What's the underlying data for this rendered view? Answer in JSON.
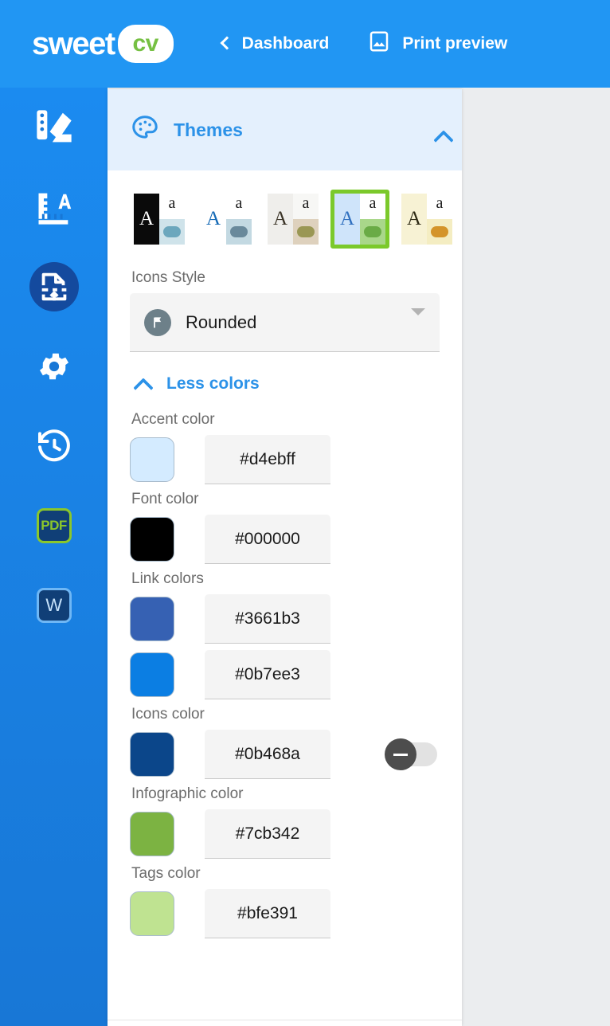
{
  "header": {
    "logo_word": "sweet",
    "logo_pill": "cv",
    "back_icon": "chevron-left-icon",
    "dashboard_label": "Dashboard",
    "print_icon": "image-icon",
    "print_label": "Print preview",
    "bg_color": "#2196f3",
    "logo_pill_color": "#76c043"
  },
  "sidebar": {
    "items": [
      {
        "name": "themes",
        "icon": "palette-swatches-icon",
        "active": false
      },
      {
        "name": "typography",
        "icon": "ruler-letter-icon",
        "active": false
      },
      {
        "name": "layout",
        "icon": "document-upload-icon",
        "active": true
      },
      {
        "name": "settings",
        "icon": "gear-icon",
        "active": false
      },
      {
        "name": "history",
        "icon": "history-clock-icon",
        "active": false
      },
      {
        "name": "export-pdf",
        "icon": "pdf-badge-icon",
        "label": "PDF",
        "active": false
      },
      {
        "name": "export-word",
        "icon": "word-badge-icon",
        "label": "W",
        "active": false
      }
    ]
  },
  "panel": {
    "icon": "palette-icon",
    "title": "Themes",
    "collapse_icon": "chevron-up-icon",
    "header_bg": "#e4f0fd",
    "title_color": "#2c92e8"
  },
  "themes": {
    "selected_index": 3,
    "selection_color": "#7bc92b",
    "items": [
      {
        "name": "theme-dark",
        "letter": "A",
        "small_letter": "a",
        "left_bg": "#0a0a0a",
        "left_fg": "#ffffff",
        "small_bg": "#ffffff",
        "small_fg": "#1a1a1a",
        "dot_bg": "#cfe3ea",
        "dot_color": "#6ca7bd"
      },
      {
        "name": "theme-white-blue",
        "letter": "A",
        "small_letter": "a",
        "left_bg": "#ffffff",
        "left_fg": "#1469b5",
        "small_bg": "#ffffff",
        "small_fg": "#1a1a1a",
        "dot_bg": "#c3d9e2",
        "dot_color": "#69899b"
      },
      {
        "name": "theme-cream-olive",
        "letter": "A",
        "small_letter": "a",
        "left_bg": "#efeeeb",
        "left_fg": "#3a3326",
        "small_bg": "#f7f7f5",
        "small_fg": "#1a1a1a",
        "dot_bg": "#ded1bd",
        "dot_color": "#9a9754"
      },
      {
        "name": "theme-blue-green",
        "letter": "A",
        "small_letter": "a",
        "left_bg": "#cfe4fa",
        "left_fg": "#2f6fbf",
        "small_bg": "#ffffff",
        "small_fg": "#1a1a1a",
        "dot_bg": "#a9d78a",
        "dot_color": "#6aab46"
      },
      {
        "name": "theme-ivory-orange",
        "letter": "A",
        "small_letter": "a",
        "left_bg": "#f7f2d4",
        "left_fg": "#2e2a14",
        "small_bg": "#ffffff",
        "small_fg": "#1a1a1a",
        "dot_bg": "#f4edc2",
        "dot_color": "#d4942a"
      }
    ]
  },
  "icons_style": {
    "label": "Icons Style",
    "value": "Rounded",
    "glyph_icon": "flag-circle-icon",
    "glyph_bg": "#6d8089",
    "caret_icon": "caret-down-icon",
    "options": [
      "Rounded"
    ]
  },
  "less_colors": {
    "icon": "chevron-up-icon",
    "label": "Less colors"
  },
  "colors": [
    {
      "name": "accent-color",
      "label": "Accent color",
      "rows": [
        {
          "swatch": "#d4ebff",
          "value": "#d4ebff"
        }
      ]
    },
    {
      "name": "font-color",
      "label": "Font color",
      "rows": [
        {
          "swatch": "#000000",
          "value": "#000000"
        }
      ]
    },
    {
      "name": "link-colors",
      "label": "Link colors",
      "rows": [
        {
          "swatch": "#3661b3",
          "value": "#3661b3"
        },
        {
          "swatch": "#0b7ee3",
          "value": "#0b7ee3"
        }
      ]
    },
    {
      "name": "icons-color",
      "label": "Icons color",
      "rows": [
        {
          "swatch": "#0b468a",
          "value": "#0b468a",
          "toggle": "off"
        }
      ]
    },
    {
      "name": "infographic-color",
      "label": "Infographic color",
      "rows": [
        {
          "swatch": "#7cb342",
          "value": "#7cb342"
        }
      ]
    },
    {
      "name": "tags-color",
      "label": "Tags color",
      "rows": [
        {
          "swatch": "#bfe391",
          "value": "#bfe391"
        }
      ]
    }
  ],
  "canvas": {
    "bg_color": "#ebedef"
  }
}
